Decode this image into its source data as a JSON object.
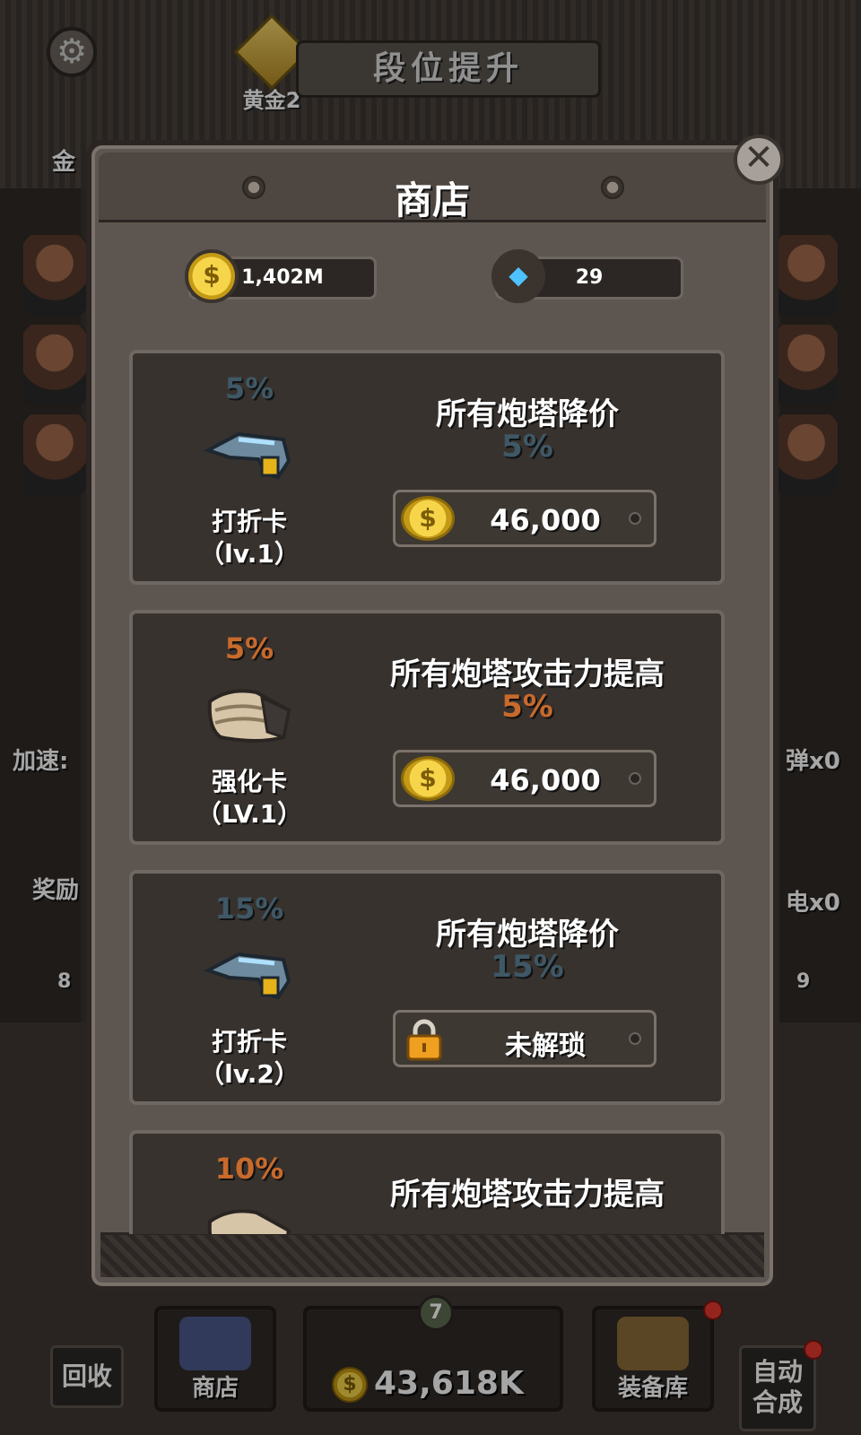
{
  "topbar": {
    "rank_name": "黄金2",
    "rank_plate": "段位提升",
    "settings_glyph": "⚙",
    "left_label_top": "金",
    "gift_label": ""
  },
  "sides": {
    "speed_label": "加速:",
    "reward_label": "奖励",
    "bomb_label": "弹x0",
    "elec_label": "电x0",
    "left_tank_level": "8",
    "right_tank_level": "9"
  },
  "shop": {
    "title": "商店",
    "close_glyph": "✕",
    "coins": "1,402M",
    "gems": "29",
    "coin_glyph": "$",
    "gem_glyph": "◆",
    "items": [
      {
        "percent": "5%",
        "percent_color": "#3f5866",
        "name_line1": "打折卡",
        "name_line2": "（lv.1）",
        "desc": "所有炮塔降价",
        "desc_percent": "5%",
        "desc_percent_color": "#3f5866",
        "price": "46,000",
        "locked": false,
        "icon": "discount-card-icon"
      },
      {
        "percent": "5%",
        "percent_color": "#c86a2c",
        "name_line1": "强化卡",
        "name_line2": "（LV.1）",
        "desc": "所有炮塔攻击力提高",
        "desc_percent": "5%",
        "desc_percent_color": "#c86a2c",
        "price": "46,000",
        "locked": false,
        "icon": "power-card-icon"
      },
      {
        "percent": "15%",
        "percent_color": "#3f5866",
        "name_line1": "打折卡",
        "name_line2": "（lv.2）",
        "desc": "所有炮塔降价",
        "desc_percent": "15%",
        "desc_percent_color": "#3f5866",
        "lock_text": "未解琐",
        "locked": true,
        "icon": "discount-card-icon"
      },
      {
        "percent": "10%",
        "percent_color": "#c86a2c",
        "desc": "所有炮塔攻击力提高",
        "icon": "power-card-icon"
      }
    ]
  },
  "bottom": {
    "recycle": "回收",
    "shop": "商店",
    "total_coins": "43,618K",
    "tank_level": "7",
    "armory": "装备库",
    "auto_merge_line1": "自动",
    "auto_merge_line2": "合成"
  }
}
